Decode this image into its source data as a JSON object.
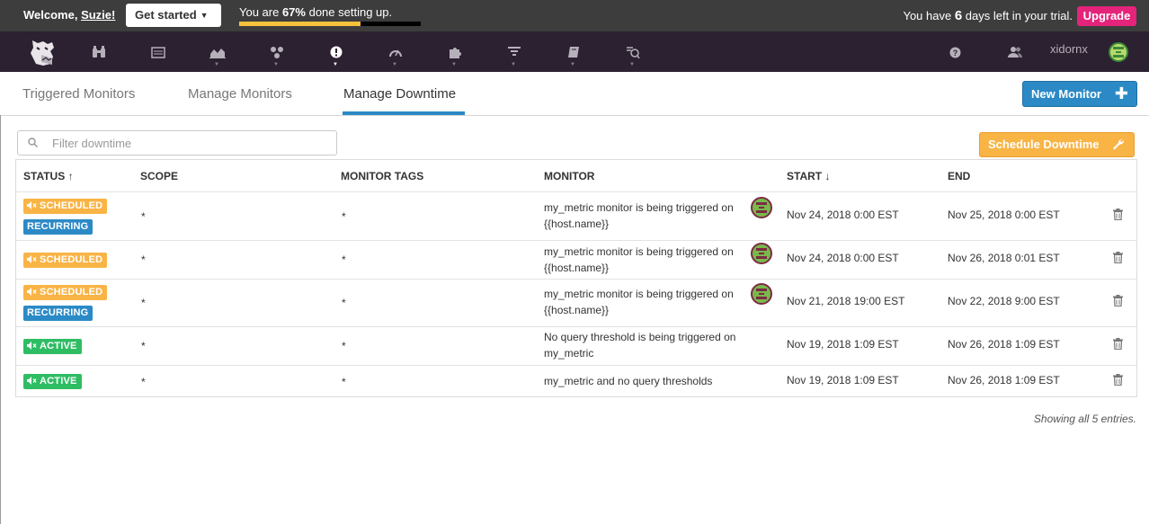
{
  "trialbar": {
    "welcome_prefix": "Welcome, ",
    "user_name": "Suzie!",
    "get_started": "Get started",
    "progress_prefix": "You are ",
    "progress_percent_label": "67%",
    "progress_suffix": " done setting up.",
    "progress_value": 0.67,
    "trial_prefix": "You have ",
    "trial_days": "6",
    "trial_suffix": " days left in your trial.",
    "upgrade": "Upgrade"
  },
  "nav": {
    "icons": [
      "binoculars-icon",
      "list-icon",
      "area-chart-icon",
      "nodes-icon",
      "alert-icon",
      "gauge-icon",
      "puzzle-icon",
      "filter-icon",
      "book-icon",
      "apm-icon"
    ],
    "help_icon": "question-icon",
    "team_icon": "users-icon",
    "org_name": "xidornx"
  },
  "tabs": {
    "items": [
      "Triggered Monitors",
      "Manage Monitors",
      "Manage Downtime"
    ],
    "active": "Manage Downtime",
    "new_monitor": "New Monitor"
  },
  "filter": {
    "placeholder": "Filter downtime"
  },
  "schedule_button": "Schedule Downtime",
  "table": {
    "headers": {
      "status": "STATUS",
      "status_sort": "↑",
      "scope": "SCOPE",
      "tags": "MONITOR TAGS",
      "monitor": "MONITOR",
      "start": "START",
      "start_sort": "↓",
      "end": "END"
    },
    "rows": [
      {
        "badges": [
          "SCHEDULED",
          "RECURRING"
        ],
        "scope": "*",
        "tags": "*",
        "monitor": "my_metric monitor is being triggered on {{host.name}}",
        "avatar": true,
        "start": "Nov 24, 2018 0:00 EST",
        "end": "Nov 25, 2018 0:00 EST"
      },
      {
        "badges": [
          "SCHEDULED"
        ],
        "scope": "*",
        "tags": "*",
        "monitor": "my_metric monitor is being triggered on {{host.name}}",
        "avatar": true,
        "start": "Nov 24, 2018 0:00 EST",
        "end": "Nov 26, 2018 0:01 EST"
      },
      {
        "badges": [
          "SCHEDULED",
          "RECURRING"
        ],
        "scope": "*",
        "tags": "*",
        "monitor": "my_metric monitor is being triggered on {{host.name}}",
        "avatar": true,
        "start": "Nov 21, 2018 19:00 EST",
        "end": "Nov 22, 2018 9:00 EST"
      },
      {
        "badges": [
          "ACTIVE"
        ],
        "scope": "*",
        "tags": "*",
        "monitor": "No query threshold is being triggered on my_metric",
        "avatar": false,
        "start": "Nov 19, 2018 1:09 EST",
        "end": "Nov 26, 2018 1:09 EST"
      },
      {
        "badges": [
          "ACTIVE"
        ],
        "scope": "*",
        "tags": "*",
        "monitor": "my_metric and no query thresholds",
        "avatar": false,
        "start": "Nov 19, 2018 1:09 EST",
        "end": "Nov 26, 2018 1:09 EST"
      }
    ]
  },
  "footer": "Showing all 5 entries.",
  "colors": {
    "scheduled": "#f9b446",
    "recurring": "#2b8ac6",
    "active": "#2fbd64",
    "upgrade": "#e4237b",
    "nav_bg": "#2b2130"
  }
}
